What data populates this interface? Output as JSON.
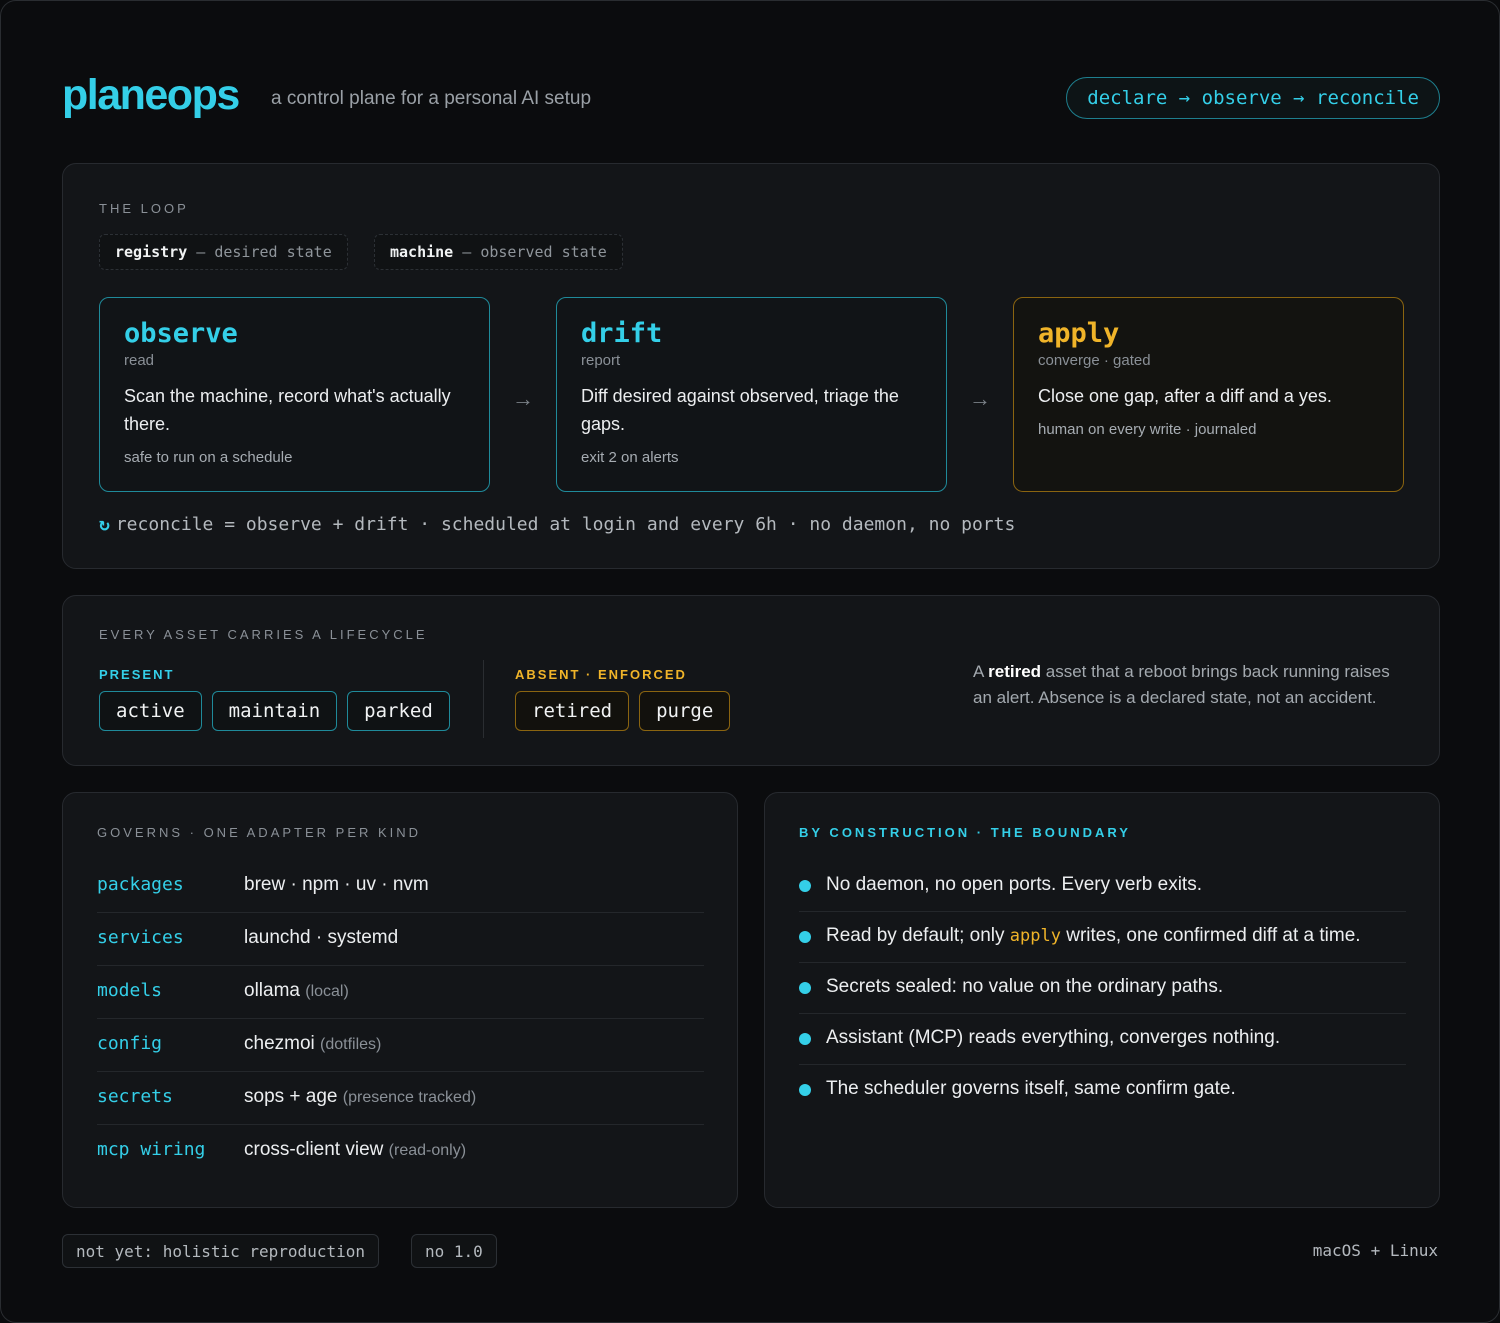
{
  "header": {
    "brand": "planeops",
    "tagline": "a control plane for a personal AI setup",
    "flow_pill": "declare → observe → reconcile"
  },
  "loop": {
    "eyebrow": "THE LOOP",
    "states": [
      {
        "name": "registry",
        "sep": " — ",
        "desc": "desired state"
      },
      {
        "name": "machine",
        "sep": " — ",
        "desc": "observed state"
      }
    ],
    "cards": [
      {
        "verb": "observe",
        "mode": "read",
        "desc": "Scan the machine, record what's actually there.",
        "note": "safe to run on a schedule"
      },
      {
        "verb": "drift",
        "mode": "report",
        "desc": "Diff desired against observed, triage the gaps.",
        "note": "exit 2 on alerts"
      },
      {
        "verb": "apply",
        "mode": "converge · gated",
        "desc": "Close one gap, after a diff and a yes.",
        "note": "human on every write · journaled"
      }
    ],
    "arrow": "→",
    "reconcile_icon": "↻",
    "reconcile_text": "reconcile = observe + drift · scheduled at login and every 6h · no daemon, no ports"
  },
  "lifecycle": {
    "eyebrow": "EVERY ASSET CARRIES A LIFECYCLE",
    "present_label": "PRESENT",
    "present": [
      "active",
      "maintain",
      "parked"
    ],
    "absent_label": "ABSENT · ENFORCED",
    "absent": [
      "retired",
      "purge"
    ],
    "note_prefix": "A ",
    "note_bold": "retired",
    "note_rest": " asset that a reboot brings back running raises an alert. Absence is a declared state, not an accident."
  },
  "governs": {
    "eyebrow": "GOVERNS · ONE ADAPTER PER KIND",
    "rows": [
      {
        "kind": "packages",
        "tools": "brew · npm · uv · nvm",
        "muted": ""
      },
      {
        "kind": "services",
        "tools": "launchd · systemd",
        "muted": ""
      },
      {
        "kind": "models",
        "tools": "ollama ",
        "muted": "(local)"
      },
      {
        "kind": "config",
        "tools": "chezmoi ",
        "muted": "(dotfiles)"
      },
      {
        "kind": "secrets",
        "tools": "sops + age ",
        "muted": "(presence tracked)"
      },
      {
        "kind": "mcp wiring",
        "tools": "cross-client view ",
        "muted": "(read-only)"
      }
    ]
  },
  "boundary": {
    "eyebrow": "BY CONSTRUCTION · THE BOUNDARY",
    "items": [
      {
        "pre": "No daemon, no open ports. Every verb exits.",
        "kw": "",
        "post": ""
      },
      {
        "pre": "Read by default; only ",
        "kw": "apply",
        "post": " writes, one confirmed diff at a time."
      },
      {
        "pre": "Secrets sealed: no value on the ordinary paths.",
        "kw": "",
        "post": ""
      },
      {
        "pre": "Assistant (MCP) reads everything, converges nothing.",
        "kw": "",
        "post": ""
      },
      {
        "pre": "The scheduler governs itself, same confirm gate.",
        "kw": "",
        "post": ""
      }
    ]
  },
  "footer": {
    "chips": [
      "not yet: holistic reproduction",
      "no 1.0"
    ],
    "platforms": "macOS + Linux"
  },
  "colors": {
    "accent": "#34cfe8",
    "amber": "#f0b429",
    "background": "#0b0c0e",
    "panel": "#131518"
  }
}
